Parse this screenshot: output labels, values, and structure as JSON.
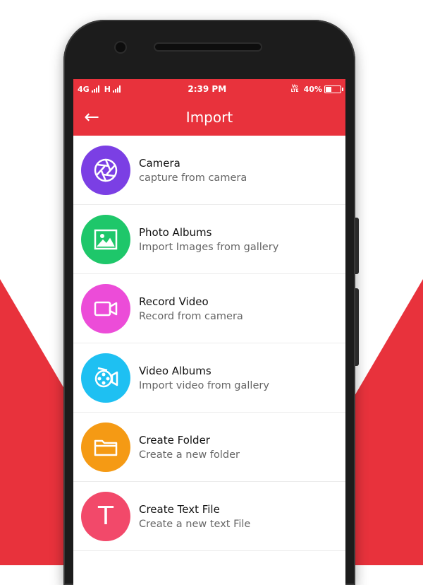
{
  "status_bar": {
    "network_1": "4G",
    "network_2": "H",
    "time": "2:39 PM",
    "volte_top": "Vo",
    "volte_bottom": "LTE",
    "battery": "40%"
  },
  "toolbar": {
    "back_icon": "←",
    "title": "Import"
  },
  "items": [
    {
      "title": "Camera",
      "subtitle": "capture from camera",
      "color": "#7b3fe4",
      "icon": "camera-shutter-icon"
    },
    {
      "title": "Photo Albums",
      "subtitle": "Import Images from gallery",
      "color": "#1ec76a",
      "icon": "image-icon"
    },
    {
      "title": "Record Video",
      "subtitle": "Record from camera",
      "color": "#ec4cd8",
      "icon": "video-camera-icon"
    },
    {
      "title": "Video Albums",
      "subtitle": "Import video from gallery",
      "color": "#1ec0f2",
      "icon": "film-reel-icon"
    },
    {
      "title": "Create Folder",
      "subtitle": "Create a new folder",
      "color": "#f59a14",
      "icon": "folder-icon"
    },
    {
      "title": "Create Text File",
      "subtitle": "Create a new text File",
      "color": "#f2496a",
      "icon": "text-file-icon",
      "letter": "T"
    }
  ],
  "colors": {
    "accent": "#e8323c"
  }
}
